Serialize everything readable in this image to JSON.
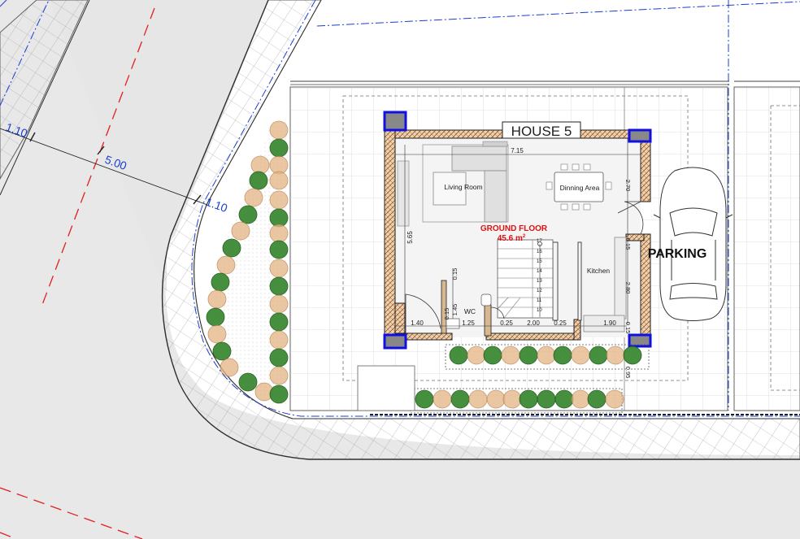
{
  "drawing": {
    "house_title": "HOUSE 5",
    "floor_label": "GROUND FLOOR",
    "floor_area": "45.6 m",
    "floor_area_sup": "2",
    "parking_label": "PARKING",
    "rooms": {
      "living": "Living Room",
      "dining": "Dinning Area",
      "kitchen": "Kitchen",
      "wc": "WC"
    }
  },
  "road_dimensions": {
    "d1": "1.10",
    "d2": "5.00",
    "d3": "1.10"
  },
  "dimensions": {
    "top_width": "7.15",
    "left_height": "5.65",
    "right_upper": "2.70",
    "right_mid": "0.15",
    "right_lower": "2.80",
    "right_bottom": "0.15",
    "right_foot": "0.95",
    "wc_top": "0.15",
    "wc_mid": "1.45",
    "wc_small": "0.15",
    "bottom_a": "1.40",
    "bottom_b": "1.25",
    "bottom_c": "0.25",
    "bottom_d": "2.00",
    "bottom_e": "0.25",
    "bottom_f": "1.90"
  },
  "stairs": {
    "steps": [
      "17",
      "16",
      "15",
      "14",
      "13",
      "12",
      "11",
      "10"
    ]
  },
  "colors": {
    "wall_hatch": "#e8cfa8",
    "column_blue": "#1010e0",
    "axis_red": "#e02020",
    "dim_blue": "#1a3fd0",
    "label_red": "#e01010",
    "tree_green": "#3d8a35",
    "shrub_tan": "#e3b583"
  }
}
